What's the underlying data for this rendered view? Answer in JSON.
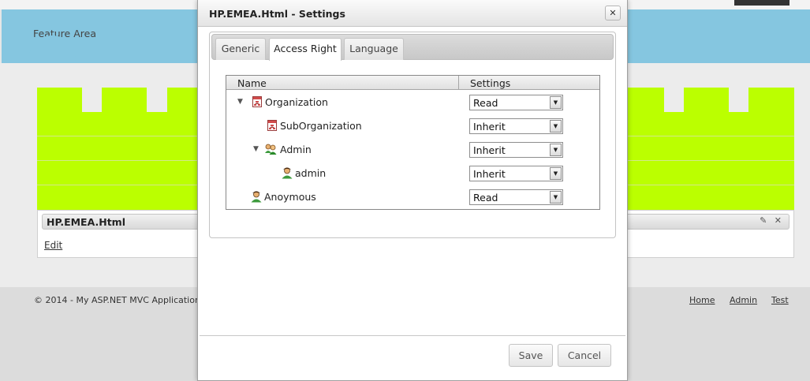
{
  "page": {
    "feature_area": "Feature Area",
    "module": {
      "title": "HP.EMEA.Html",
      "tools": "✎ ✕",
      "edit": "Edit"
    },
    "footer": {
      "copyright": "© 2014 - My ASP.NET MVC Application",
      "nav": [
        "Home",
        "Admin",
        "Test"
      ]
    }
  },
  "dialog": {
    "title": "HP.EMEA.Html - Settings",
    "close": "✕",
    "tabs": [
      {
        "label": "Generic",
        "active": false
      },
      {
        "label": "Access Right",
        "active": true
      },
      {
        "label": "Language",
        "active": false
      }
    ],
    "grid": {
      "columns": [
        "Name",
        "Settings"
      ],
      "rows": [
        {
          "name": "Organization",
          "icon": "organization-icon",
          "expander": "▼",
          "setting": "Read"
        },
        {
          "name": "SubOrganization",
          "icon": "organization-icon",
          "expander": "",
          "setting": "Inherit"
        },
        {
          "name": "Admin",
          "icon": "user-group-icon",
          "expander": "▼",
          "setting": "Inherit"
        },
        {
          "name": "admin",
          "icon": "user-icon",
          "expander": "",
          "setting": "Inherit"
        },
        {
          "name": "Anoymous",
          "icon": "user-icon",
          "expander": "",
          "setting": "Read"
        }
      ]
    },
    "buttons": {
      "save": "Save",
      "cancel": "Cancel"
    }
  },
  "colors": {
    "feature_band": "#85c6e0",
    "grid_blocks": "#bbff00"
  }
}
